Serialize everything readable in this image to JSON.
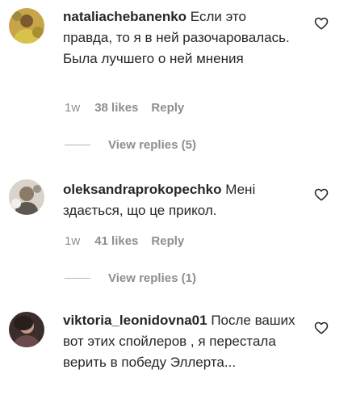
{
  "comments": [
    {
      "username": "nataliachebanenko",
      "text": "Если это правда, то я в ней разочаровалась. Была лучшего о ней мнения",
      "time": "1w",
      "likes": "38 likes",
      "reply": "Reply",
      "view_replies": "View replies (5)"
    },
    {
      "username": "oleksandraprokopechko",
      "text": "Мені здається, що це прикол.",
      "time": "1w",
      "likes": "41 likes",
      "reply": "Reply",
      "view_replies": "View replies (1)"
    },
    {
      "username": "viktoria_leonidovna01",
      "text": "После ваших вот этих спойлеров , я перестала верить в победу Эллерта..."
    }
  ],
  "icons": {
    "like": "heart-outline-icon"
  },
  "colors": {
    "text": "#262626",
    "secondary": "#8e8e8e"
  }
}
